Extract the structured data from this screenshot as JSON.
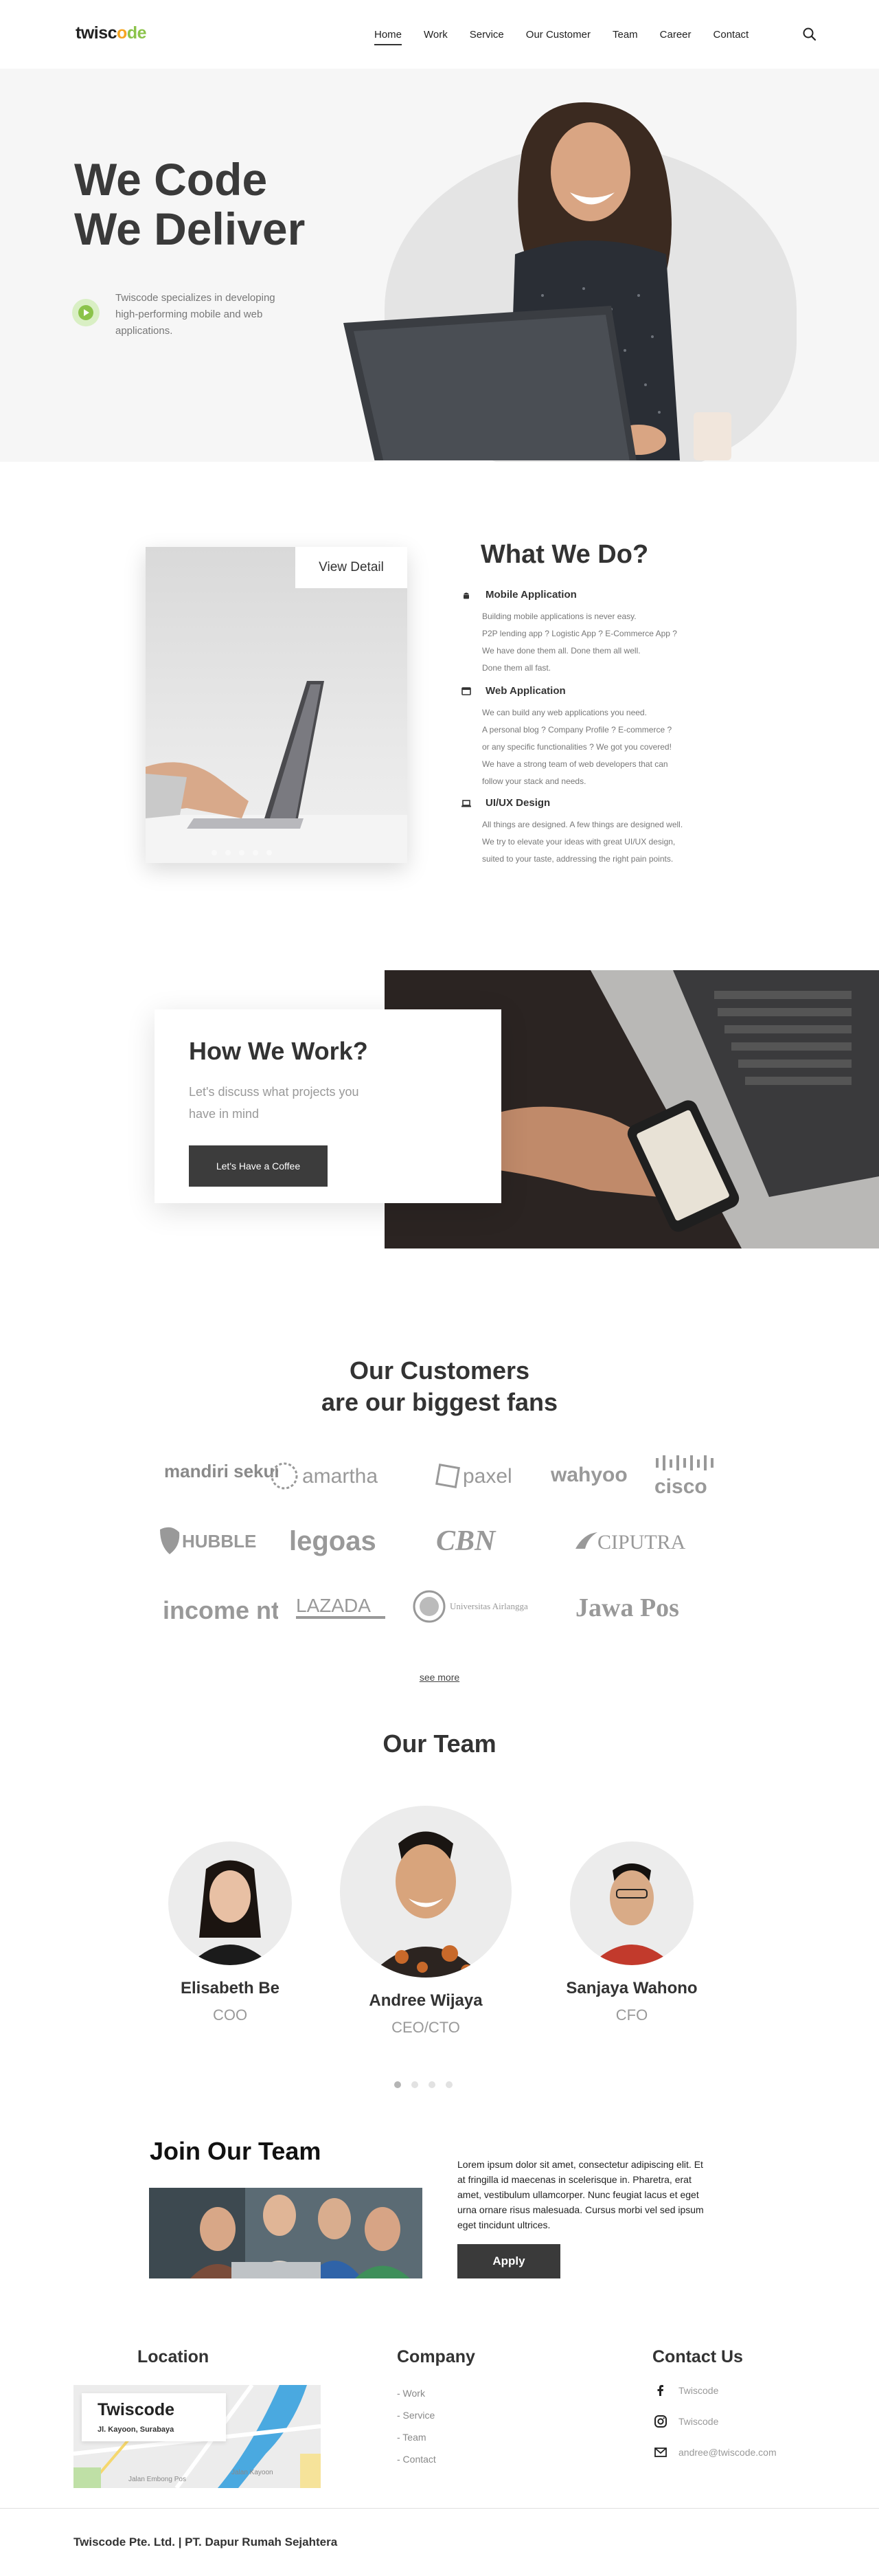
{
  "header": {
    "logo": {
      "part1": "twisc",
      "part2": "o",
      "part3": "de"
    },
    "nav": [
      "Home",
      "Work",
      "Service",
      "Our Customer",
      "Team",
      "Career",
      "Contact"
    ],
    "active_nav": "Home"
  },
  "hero": {
    "title_line1": "We Code",
    "title_line2": "We Deliver",
    "description": "Twiscode specializes in developing high-performing mobile and web applications."
  },
  "what_we_do": {
    "view_detail": "View Detail",
    "title": "What We Do?",
    "services": [
      {
        "icon": "android-icon",
        "title": "Mobile Application",
        "desc": "Building mobile applications is never easy.\nP2P lending app ? Logistic App ? E-Commerce App ?\nWe have done them all. Done them all well.\nDone them all fast."
      },
      {
        "icon": "browser-window-icon",
        "title": "Web Application",
        "desc": "We can build any web applications you need.\nA personal blog ? Company Profile ? E-commerce ?\nor any specific functionalities ? We got you covered!\nWe have a strong team of web developers that can\nfollow your stack and needs."
      },
      {
        "icon": "laptop-icon",
        "title": "UI/UX Design",
        "desc": "All things are designed. A few things are designed well.\nWe try to elevate your ideas with great UI/UX design,\nsuited to your taste, addressing the right pain points."
      }
    ]
  },
  "how_we_work": {
    "title": "How We Work?",
    "subtitle": "Let's discuss what projects you have in mind",
    "button": "Let's Have a Coffee"
  },
  "customers": {
    "title_line1": "Our Customers",
    "title_line2": "are our biggest fans",
    "logos": [
      "mandiri sekuritas",
      "amartha",
      "paxel",
      "wahyoo",
      "cisco",
      "HUBBLE",
      "legoas",
      "CBN",
      "CIPUTRA",
      "income ntuc",
      "LAZADA",
      "Universitas Airlangga",
      "Jawa Pos"
    ],
    "see_more": "see more"
  },
  "team": {
    "title": "Our Team",
    "members": [
      {
        "name": "Elisabeth Be",
        "role": "COO"
      },
      {
        "name": "Andree Wijaya",
        "role": "CEO/CTO"
      },
      {
        "name": "Sanjaya Wahono",
        "role": "CFO"
      }
    ],
    "carousel_pages": 4,
    "carousel_active": 1
  },
  "join": {
    "title": "Join Our Team",
    "text": "Lorem ipsum dolor sit amet, consectetur adipiscing elit. Et at fringilla id maecenas in scelerisque in. Pharetra, erat amet, vestibulum ullamcorper. Nunc feugiat lacus et eget urna ornare risus malesuada. Cursus morbi vel sed ipsum eget tincidunt ultrices.",
    "button": "Apply"
  },
  "footer": {
    "location_heading": "Location",
    "map_title": "Twiscode",
    "map_address": "Jl. Kayoon, Surabaya",
    "map_streets": [
      "Jalan Embong Pos",
      "Jalan Kayoon"
    ],
    "company_heading": "Company",
    "company_links": [
      "- Work",
      "- Service",
      "- Team",
      "- Contact"
    ],
    "contact_heading": "Contact Us",
    "contacts": [
      {
        "icon": "facebook-icon",
        "text": "Twiscode"
      },
      {
        "icon": "instagram-icon",
        "text": "Twiscode"
      },
      {
        "icon": "mail-icon",
        "text": "andree@twiscode.com"
      }
    ],
    "copyright": "Twiscode Pte. Ltd. | PT. Dapur Rumah Sejahtera"
  },
  "colors": {
    "accent_green": "#8bc34a",
    "accent_orange": "#f5a623",
    "dark_button": "#3c3c3c"
  }
}
